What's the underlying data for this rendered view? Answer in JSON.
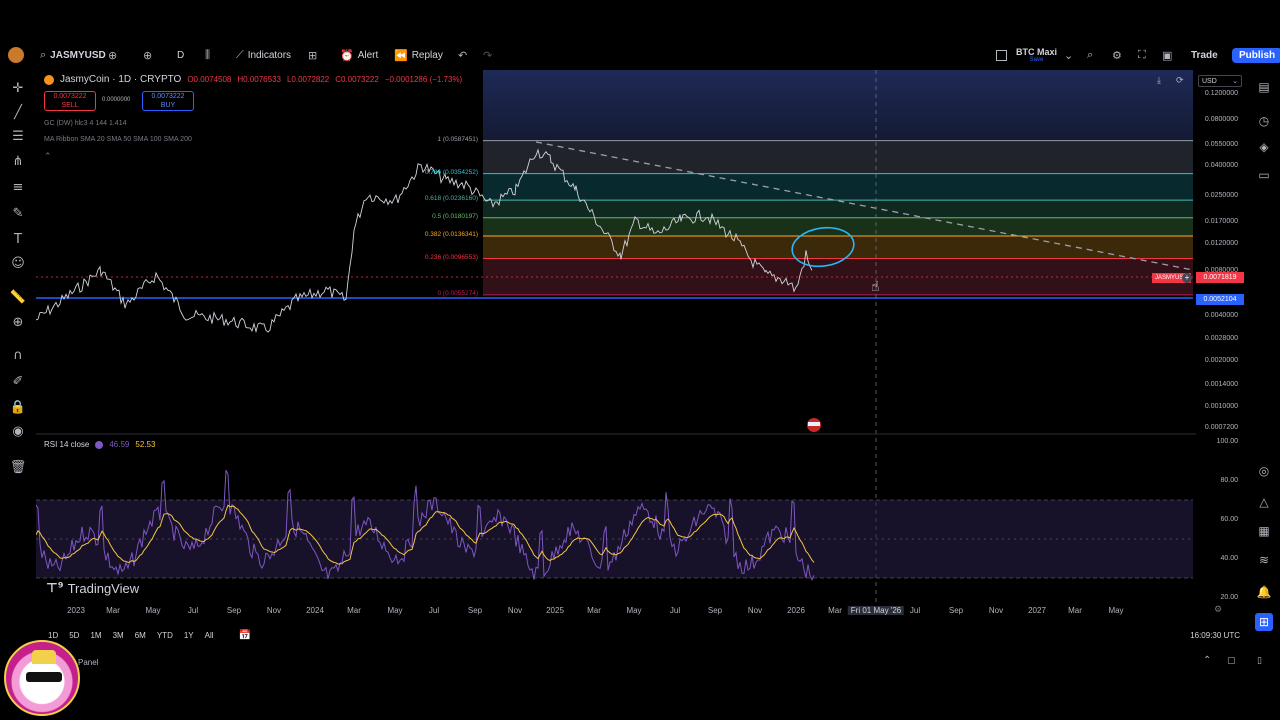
{
  "topbar": {
    "symbol": "JASMYUSD",
    "interval": "D",
    "indicators_label": "Indicators",
    "alert_label": "Alert",
    "replay_label": "Replay",
    "layout_name": "BTC Maxi",
    "layout_sub": "Save",
    "trade_label": "Trade",
    "publish_label": "Publish"
  },
  "legend": {
    "title": "JasmyCoin · 1D · CRYPTO",
    "o": "O0.0074508",
    "h": "H0.0076533",
    "l": "L0.0072822",
    "c": "C0.0073222",
    "chg": "−0.0001286 (−1.73%)",
    "sell_price": "0.0073222",
    "sell_label": "SELL",
    "spread": "0.0000000",
    "buy_price": "0.0073222",
    "buy_label": "BUY",
    "ind1": "GC (DW) hlc3 4 144 1.414",
    "ind2": "MA Ribbon SMA 20 SMA 50 SMA 100 SMA 200"
  },
  "fib_levels": [
    {
      "label": "1 (0.0587451)",
      "price": 0.0587451
    },
    {
      "label": "0.786 (0.0354252)",
      "price": 0.0354252
    },
    {
      "label": "0.618 (0.0236160)",
      "price": 0.023616
    },
    {
      "label": "0.5 (0.0180197)",
      "price": 0.0180197
    },
    {
      "label": "0.382 (0.0136341)",
      "price": 0.0136341
    },
    {
      "label": "0.236 (0.0096553)",
      "price": 0.0096553
    },
    {
      "label": "0 (0.0055274)",
      "price": 0.0055274
    }
  ],
  "price_axis": {
    "currency": "USD",
    "ticks": [
      "0.1200000",
      "0.0800000",
      "0.0550000",
      "0.0400000",
      "0.0250000",
      "0.0170000",
      "0.0120000",
      "0.0080000",
      "0.0040000",
      "0.0028000",
      "0.0020000",
      "0.0014000",
      "0.0010000",
      "0.0007200"
    ],
    "current_label": "JASMYUSD",
    "current_value": "0.0071819",
    "support_value": "0.0052104"
  },
  "rsi": {
    "title": "RSI 14 close",
    "value1": "46.59",
    "value2": "52.53",
    "ticks": [
      "100.00",
      "80.00",
      "60.00",
      "40.00",
      "20.00"
    ]
  },
  "time_axis": {
    "labels": [
      "2023",
      "Mar",
      "May",
      "Jul",
      "Sep",
      "Nov",
      "2024",
      "Mar",
      "May",
      "Jul",
      "Sep",
      "Nov",
      "2025",
      "Mar",
      "May",
      "Jul",
      "Sep",
      "Nov",
      "2026",
      "Mar",
      "Jul",
      "Sep",
      "Nov",
      "2027",
      "Mar",
      "May"
    ],
    "crosshair": "Fri 01 May '26"
  },
  "bottom": {
    "ranges": [
      "1D",
      "5D",
      "1M",
      "3M",
      "6M",
      "YTD",
      "1Y",
      "All"
    ],
    "time": "16:09:30 UTC",
    "panel_label": "Panel"
  },
  "watermark": "TradingView",
  "colors": {
    "bg": "#000000",
    "accent": "#2962ff",
    "rsi_line": "#7e57c2",
    "rsi_ma": "#f5c542",
    "fib_red": "#f23645",
    "support": "#2962ff"
  }
}
